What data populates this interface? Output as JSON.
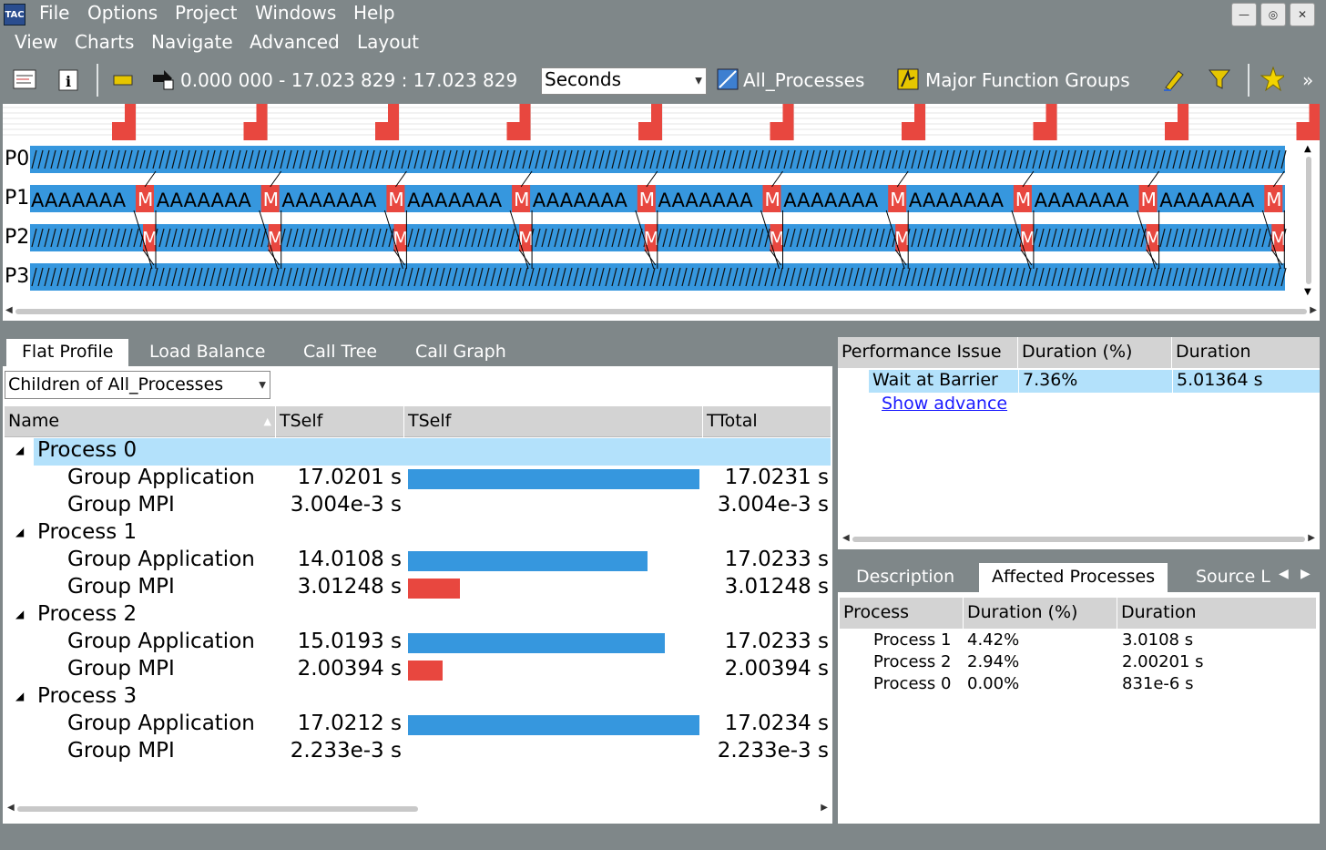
{
  "app": {
    "logo": "TAC"
  },
  "menu1": [
    "File",
    "Options",
    "Project",
    "Windows",
    "Help"
  ],
  "menu2": [
    "View",
    "Charts",
    "Navigate",
    "Advanced",
    "Layout"
  ],
  "toolbar": {
    "time_range": "0.000 000 - 17.023 829 : 17.023 829",
    "unit": "Seconds",
    "process_group": "All_Processes",
    "function_group": "Major Function Groups",
    "more": "»"
  },
  "timeline": {
    "rows": [
      "P0",
      "P1",
      "P2",
      "P3"
    ],
    "mpi_label": "M",
    "app_label": "AAAAAAA",
    "iterations": 10,
    "colors": {
      "app": "#3697de",
      "mpi": "#e8473f"
    }
  },
  "flat_profile": {
    "tabs": [
      "Flat Profile",
      "Load Balance",
      "Call Tree",
      "Call Graph"
    ],
    "filter": "Children of  All_Processes",
    "columns": [
      "Name",
      "TSelf",
      "TSelf",
      "TTotal"
    ],
    "rows": [
      {
        "name": "Process 0",
        "tself": "",
        "ttotal": "",
        "level": 0,
        "bar": 0,
        "color": ""
      },
      {
        "name": "Group Application",
        "tself": "17.0201 s",
        "ttotal": "17.0231 s",
        "level": 1,
        "bar": 1.0,
        "color": "#3697de"
      },
      {
        "name": "Group MPI",
        "tself": "3.004e-3 s",
        "ttotal": "3.004e-3 s",
        "level": 1,
        "bar": 0,
        "color": "#e8473f"
      },
      {
        "name": "Process 1",
        "tself": "",
        "ttotal": "",
        "level": 0,
        "bar": 0,
        "color": ""
      },
      {
        "name": "Group Application",
        "tself": "14.0108 s",
        "ttotal": "17.0233 s",
        "level": 1,
        "bar": 0.823,
        "color": "#3697de"
      },
      {
        "name": "Group MPI",
        "tself": "3.01248 s",
        "ttotal": "3.01248 s",
        "level": 1,
        "bar": 0.177,
        "color": "#e8473f"
      },
      {
        "name": "Process 2",
        "tself": "",
        "ttotal": "",
        "level": 0,
        "bar": 0,
        "color": ""
      },
      {
        "name": "Group Application",
        "tself": "15.0193 s",
        "ttotal": "17.0233 s",
        "level": 1,
        "bar": 0.882,
        "color": "#3697de"
      },
      {
        "name": "Group MPI",
        "tself": "2.00394 s",
        "ttotal": "2.00394 s",
        "level": 1,
        "bar": 0.118,
        "color": "#e8473f"
      },
      {
        "name": "Process 3",
        "tself": "",
        "ttotal": "",
        "level": 0,
        "bar": 0,
        "color": ""
      },
      {
        "name": "Group Application",
        "tself": "17.0212 s",
        "ttotal": "17.0234 s",
        "level": 1,
        "bar": 1.0,
        "color": "#3697de"
      },
      {
        "name": "Group MPI",
        "tself": "2.233e-3 s",
        "ttotal": "2.233e-3 s",
        "level": 1,
        "bar": 0,
        "color": "#e8473f"
      }
    ]
  },
  "performance": {
    "columns": [
      "Performance Issue",
      "Duration (%)",
      "Duration"
    ],
    "row": {
      "issue": "Wait at Barrier",
      "pct": "7.36%",
      "duration": "5.01364 s"
    },
    "link": "Show advance"
  },
  "details": {
    "tabs": [
      "Description",
      "Affected Processes",
      "Source L"
    ],
    "columns": [
      "Process",
      "Duration (%)",
      "Duration"
    ],
    "rows": [
      {
        "process": "Process 1",
        "pct": "4.42%",
        "duration": "3.0108 s"
      },
      {
        "process": "Process 2",
        "pct": "2.94%",
        "duration": "2.00201 s"
      },
      {
        "process": "Process 0",
        "pct": "0.00%",
        "duration": "831e-6 s"
      }
    ]
  }
}
